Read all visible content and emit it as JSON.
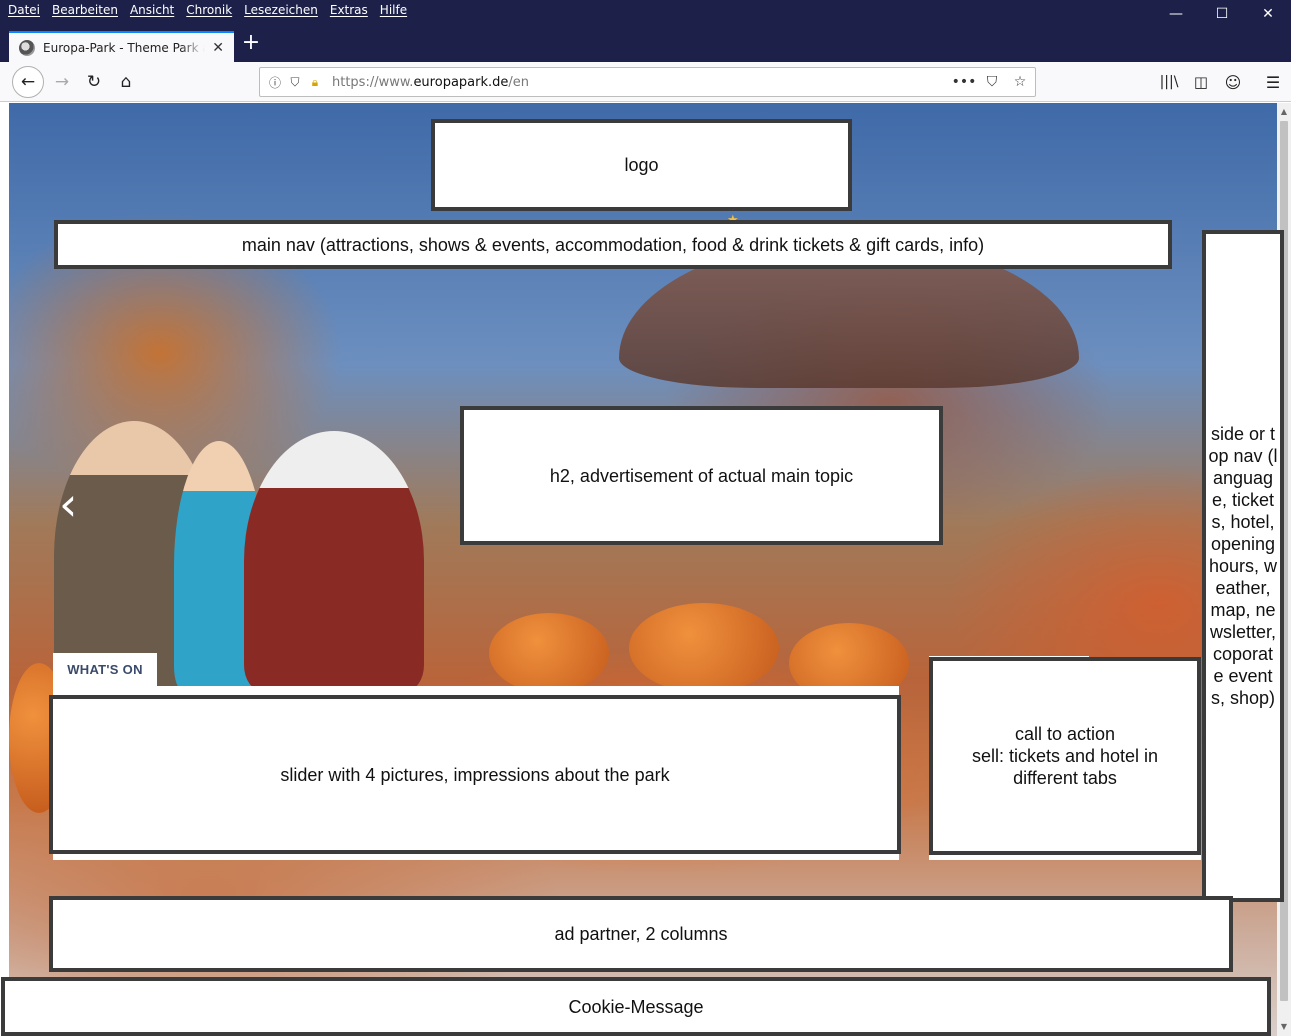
{
  "browser": {
    "menu": [
      "Datei",
      "Bearbeiten",
      "Ansicht",
      "Chronik",
      "Lesezeichen",
      "Extras",
      "Hilfe"
    ],
    "window_controls": {
      "minimize": "—",
      "maximize": "☐",
      "close": "✕"
    },
    "tab": {
      "title": "Europa-Park - Theme Park and",
      "close": "✕",
      "favicon": "europa-park-favicon"
    },
    "new_tab": "+",
    "url": {
      "scheme": "https://www.",
      "host": "europapark.de",
      "path": "/en"
    },
    "icons": [
      "back-arrow-icon",
      "forward-arrow-icon",
      "reload-icon",
      "home-icon",
      "info-icon",
      "shield-icon",
      "lock-warning-icon",
      "more-icon",
      "pocket-icon",
      "star-icon",
      "library-icon",
      "sidebar-icon",
      "account-icon",
      "hamburger-menu-icon"
    ]
  },
  "page": {
    "whats_on": "WHAT'S ON",
    "wireframes": {
      "logo": "logo",
      "main_nav": "main nav (attractions, shows & events, accommodation, food & drink tickets & gift cards, info)",
      "h2": "h2, advertisement of actual main topic",
      "side_nav": "side or top nav (language, tickets, hotel, opening hours, weather, map, newsletter, coporate events, shop)",
      "slider": "slider with 4 pictures, impressions about the park",
      "cta_line1": "call to action",
      "cta_line2": "sell: tickets and hotel in different tabs",
      "ad_partner": "ad partner, 2 columns",
      "cookie": "Cookie-Message"
    }
  }
}
